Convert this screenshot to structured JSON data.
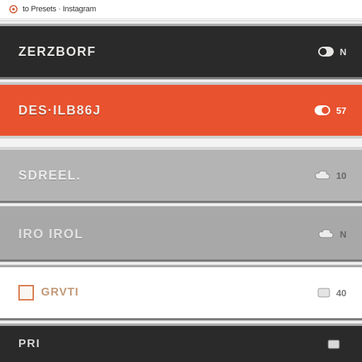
{
  "header": {
    "title": "to Presets · Instagram"
  },
  "rows": [
    {
      "label": "ZERZBORF",
      "count": "N",
      "style": "dark",
      "icon": "badge",
      "icon_fill": "#e8e6e4",
      "icon_stroke": "#2a2a2a"
    },
    {
      "label": "DES·ILB86J",
      "count": "57",
      "style": "orange",
      "icon": "badge",
      "icon_fill": "#ffffff",
      "icon_stroke": "#e8522f"
    },
    {
      "label": "SDREEL.",
      "count": "10",
      "style": "grey1",
      "icon": "cloud",
      "icon_fill": "#e8e8e8",
      "icon_stroke": "#8a8a8a"
    },
    {
      "label": "IRO IROL",
      "count": "N",
      "style": "grey2",
      "icon": "cloud",
      "icon_fill": "#e8e8e8",
      "icon_stroke": "#8a8a8a"
    },
    {
      "label": "GRVTI",
      "count": "40",
      "style": "white",
      "icon": "thumb",
      "icon_fill": "#e0e0e0",
      "icon_stroke": "#999"
    },
    {
      "label": "PRI",
      "count": "",
      "style": "dark2",
      "icon": "thumb",
      "icon_fill": "#d8d8d8",
      "icon_stroke": "#2a2a2a"
    }
  ]
}
